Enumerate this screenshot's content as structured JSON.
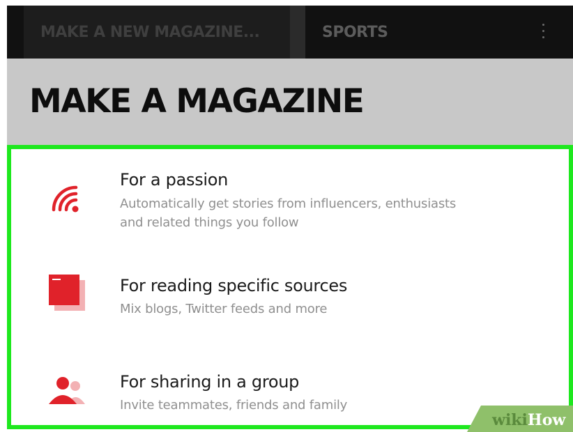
{
  "tabs": [
    {
      "label": "MAKE A NEW MAGAZINE..."
    },
    {
      "label": "SPORTS"
    }
  ],
  "header": {
    "title": "MAKE A MAGAZINE"
  },
  "options": [
    {
      "icon": "rss-feed-icon",
      "title": "For a passion",
      "description_line1": "Automatically get stories from influencers, enthusiasts",
      "description_line2": "and related things you follow"
    },
    {
      "icon": "stacked-sources-icon",
      "title": "For reading specific sources",
      "description_line1": "Mix blogs, Twitter feeds and more"
    },
    {
      "icon": "group-people-icon",
      "title": "For sharing in a group",
      "description_line1": "Invite teammates, friends and family"
    }
  ],
  "watermark": {
    "part1": "wiki",
    "part2": "How"
  },
  "colors": {
    "accent_red": "#e0222a",
    "accent_pink": "#f3b1b4",
    "highlight_green": "#1ee81e",
    "topbar": "#111111",
    "header_bg": "#c8c8c8"
  }
}
